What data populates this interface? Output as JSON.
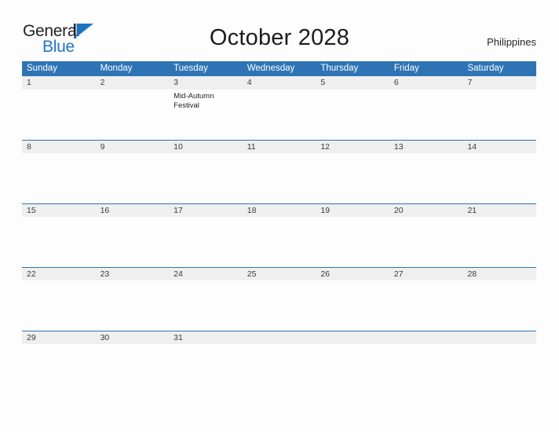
{
  "brand": {
    "name_part1": "General",
    "name_part2": "Blue",
    "mark": "blue-triangle-flag",
    "accent_color": "#2277c8"
  },
  "header": {
    "title": "October 2028",
    "region": "Philippines"
  },
  "theme": {
    "header_blue": "#2e74b5",
    "band_gray": "#efefef",
    "page_background": "#fdfdfd"
  },
  "calendar": {
    "month": "October",
    "year": "2028",
    "day_headers": [
      "Sunday",
      "Monday",
      "Tuesday",
      "Wednesday",
      "Thursday",
      "Friday",
      "Saturday"
    ],
    "weeks": [
      [
        {
          "date": "1",
          "event": ""
        },
        {
          "date": "2",
          "event": ""
        },
        {
          "date": "3",
          "event": "Mid-Autumn Festival"
        },
        {
          "date": "4",
          "event": ""
        },
        {
          "date": "5",
          "event": ""
        },
        {
          "date": "6",
          "event": ""
        },
        {
          "date": "7",
          "event": ""
        }
      ],
      [
        {
          "date": "8",
          "event": ""
        },
        {
          "date": "9",
          "event": ""
        },
        {
          "date": "10",
          "event": ""
        },
        {
          "date": "11",
          "event": ""
        },
        {
          "date": "12",
          "event": ""
        },
        {
          "date": "13",
          "event": ""
        },
        {
          "date": "14",
          "event": ""
        }
      ],
      [
        {
          "date": "15",
          "event": ""
        },
        {
          "date": "16",
          "event": ""
        },
        {
          "date": "17",
          "event": ""
        },
        {
          "date": "18",
          "event": ""
        },
        {
          "date": "19",
          "event": ""
        },
        {
          "date": "20",
          "event": ""
        },
        {
          "date": "21",
          "event": ""
        }
      ],
      [
        {
          "date": "22",
          "event": ""
        },
        {
          "date": "23",
          "event": ""
        },
        {
          "date": "24",
          "event": ""
        },
        {
          "date": "25",
          "event": ""
        },
        {
          "date": "26",
          "event": ""
        },
        {
          "date": "27",
          "event": ""
        },
        {
          "date": "28",
          "event": ""
        }
      ],
      [
        {
          "date": "29",
          "event": ""
        },
        {
          "date": "30",
          "event": ""
        },
        {
          "date": "31",
          "event": ""
        },
        {
          "date": "",
          "event": ""
        },
        {
          "date": "",
          "event": ""
        },
        {
          "date": "",
          "event": ""
        },
        {
          "date": "",
          "event": ""
        }
      ]
    ]
  }
}
